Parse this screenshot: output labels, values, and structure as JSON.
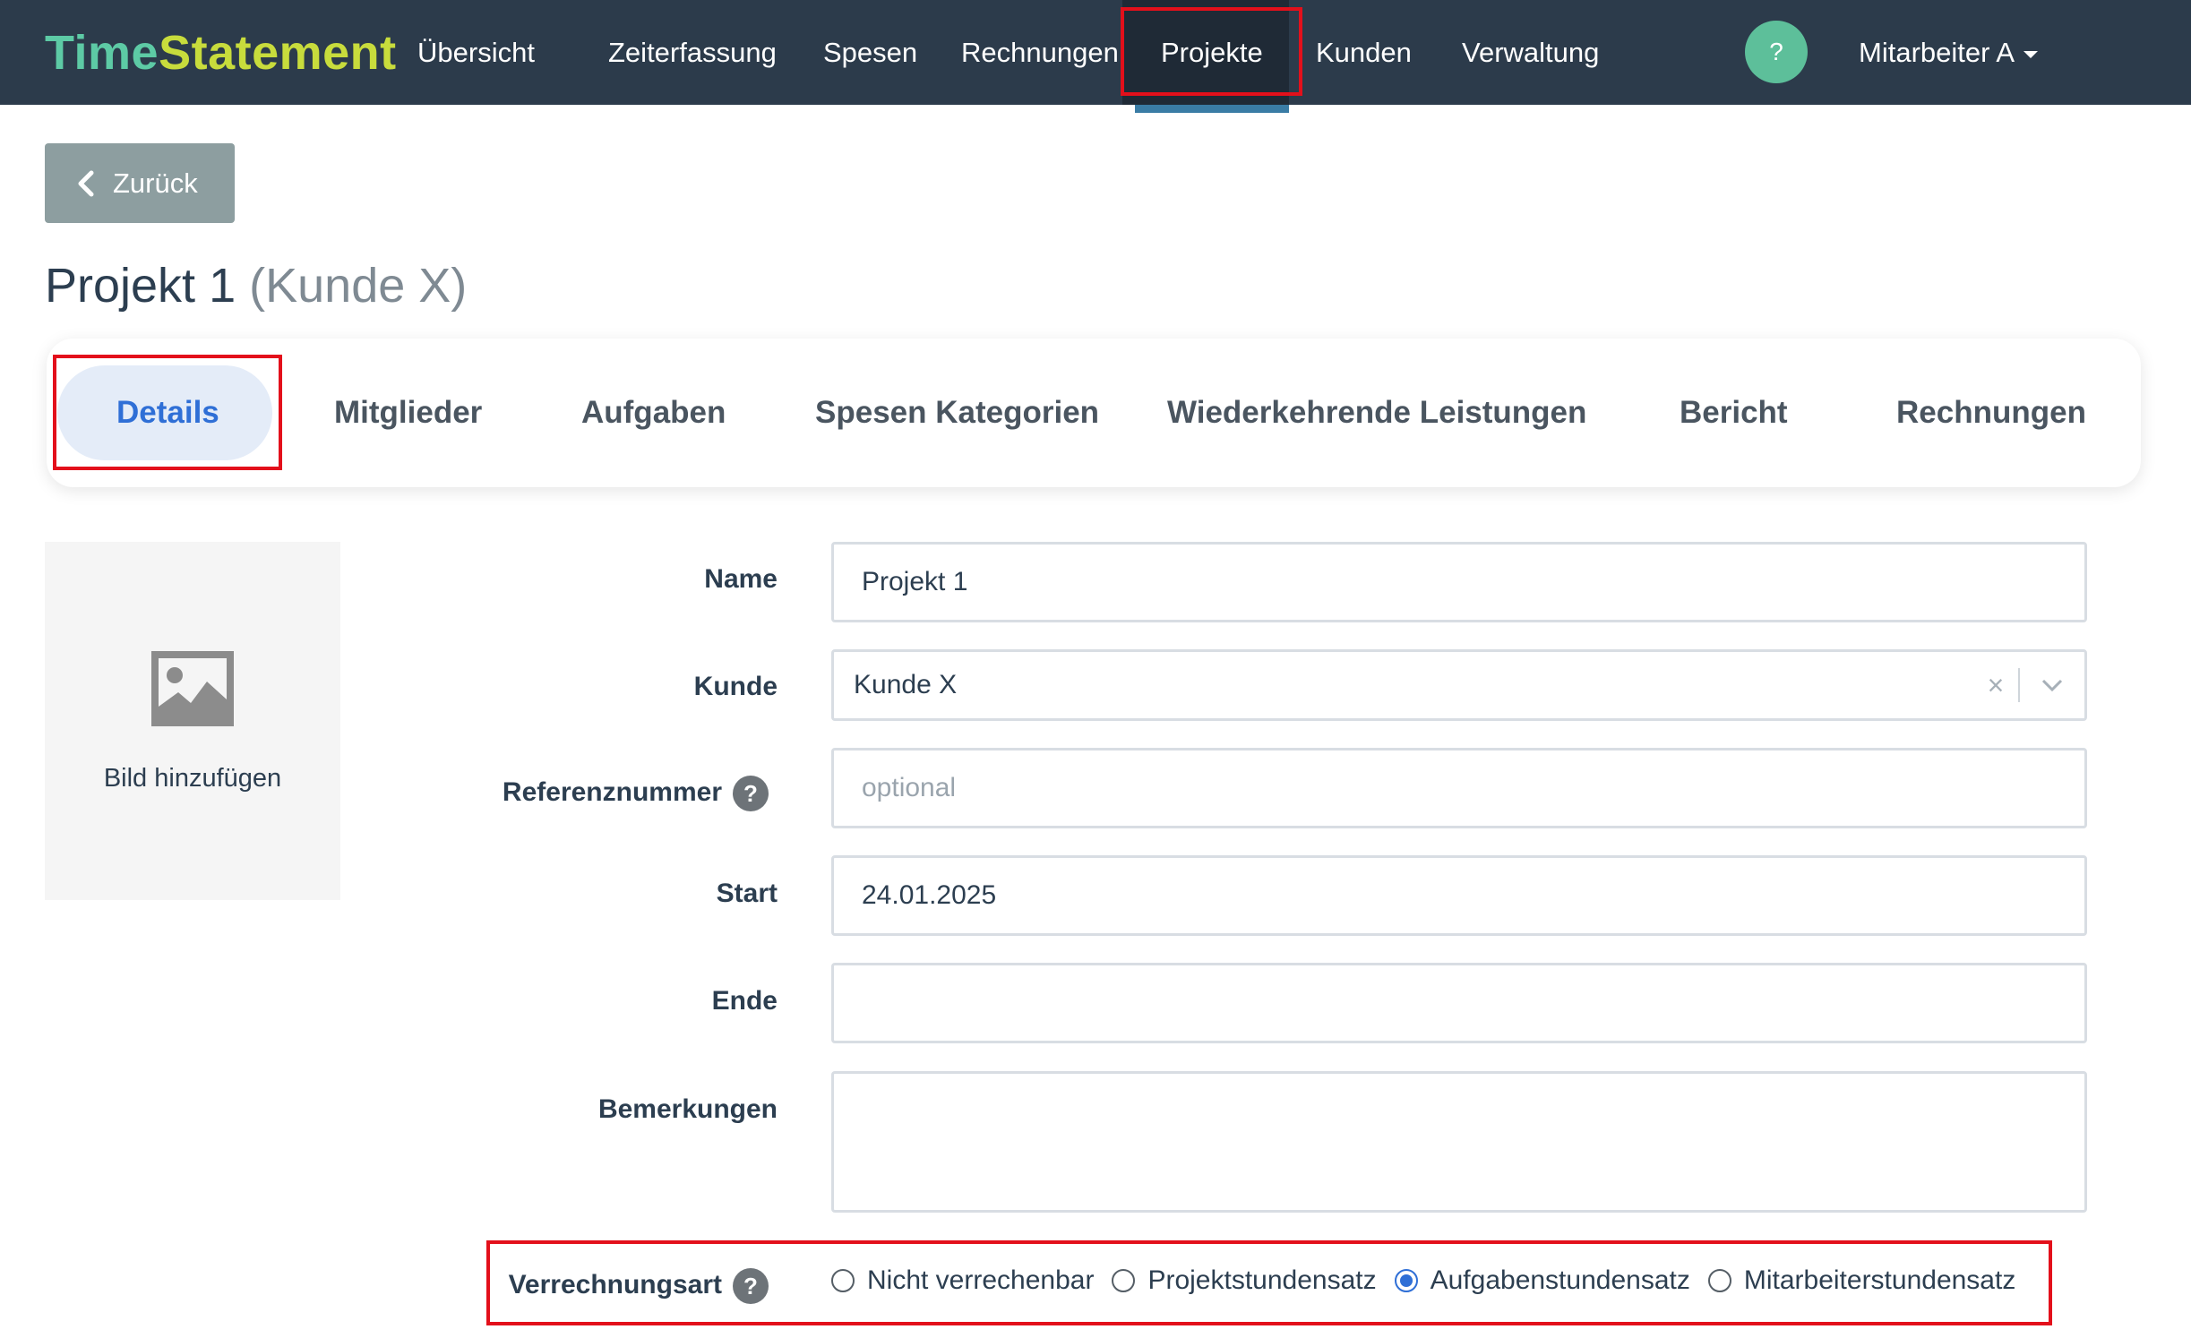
{
  "brand": {
    "part1": "Time",
    "part2": "Statement"
  },
  "nav": {
    "items": [
      {
        "label": "Übersicht"
      },
      {
        "label": "Zeiterfassung"
      },
      {
        "label": "Spesen"
      },
      {
        "label": "Rechnungen"
      },
      {
        "label": "Projekte",
        "active": true
      },
      {
        "label": "Kunden"
      },
      {
        "label": "Verwaltung"
      }
    ],
    "help": "?",
    "user": "Mitarbeiter A"
  },
  "back": {
    "label": "Zurück"
  },
  "page": {
    "title": "Projekt 1",
    "subtitle": "(Kunde X)"
  },
  "tabs": [
    {
      "label": "Details",
      "active": true
    },
    {
      "label": "Mitglieder"
    },
    {
      "label": "Aufgaben"
    },
    {
      "label": "Spesen Kategorien"
    },
    {
      "label": "Wiederkehrende Leistungen"
    },
    {
      "label": "Bericht"
    },
    {
      "label": "Rechnungen"
    }
  ],
  "image": {
    "caption": "Bild hinzufügen",
    "icon": "image-placeholder-icon"
  },
  "form": {
    "name": {
      "label": "Name",
      "value": "Projekt 1"
    },
    "kunde": {
      "label": "Kunde",
      "value": "Kunde X",
      "clear": "×"
    },
    "referenz": {
      "label": "Referenznummer",
      "placeholder": "optional",
      "help": "?"
    },
    "start": {
      "label": "Start",
      "value": "24.01.2025"
    },
    "ende": {
      "label": "Ende",
      "value": ""
    },
    "bemerkungen": {
      "label": "Bemerkungen",
      "value": ""
    },
    "verrechnungsart": {
      "label": "Verrechnungsart",
      "help": "?",
      "options": [
        {
          "label": "Nicht verrechenbar",
          "checked": false
        },
        {
          "label": "Projektstundensatz",
          "checked": false
        },
        {
          "label": "Aufgabenstundensatz",
          "checked": true
        },
        {
          "label": "Mitarbeiterstundensatz",
          "checked": false
        }
      ]
    }
  },
  "colors": {
    "nav_bg": "#2c3b4b",
    "brand_time": "#5dcaa5",
    "brand_statement": "#c8dc3c",
    "accent": "#2f6fd6",
    "highlight": "#e3101b",
    "back_button": "#8d9ea0"
  }
}
